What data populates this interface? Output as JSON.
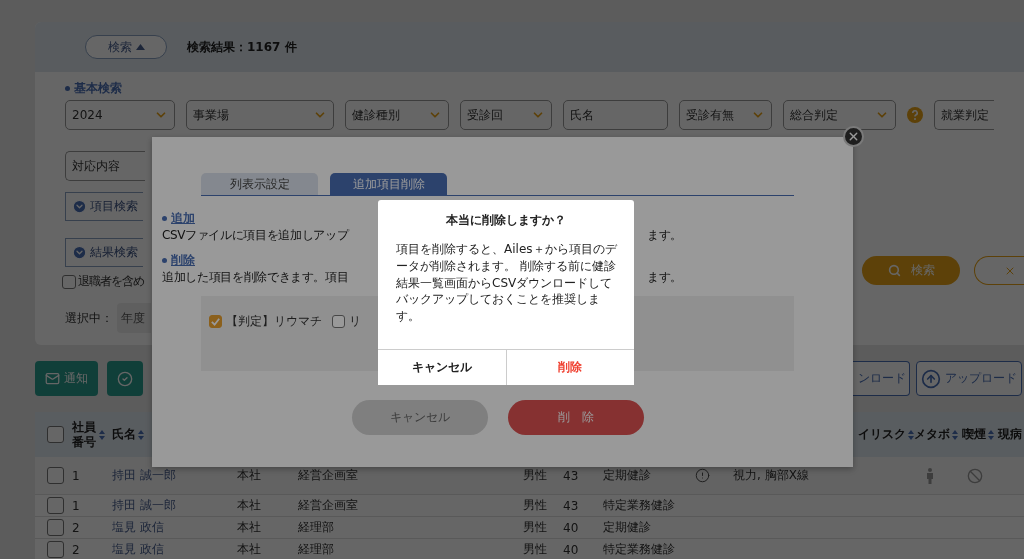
{
  "search_panel": {
    "toggle_button": "検索",
    "result_count": "検索結果：1167 件",
    "section_label": "基本検索",
    "filters": [
      {
        "kind": "select",
        "value": "2024"
      },
      {
        "kind": "select",
        "value": "事業場"
      },
      {
        "kind": "select",
        "value": "健診種別"
      },
      {
        "kind": "select",
        "value": "受診回"
      },
      {
        "kind": "input",
        "placeholder": "氏名"
      },
      {
        "kind": "select",
        "value": "受診有無"
      },
      {
        "kind": "select",
        "value": "総合判定"
      },
      {
        "kind": "help"
      },
      {
        "kind": "plain",
        "value": "就業判定"
      }
    ],
    "second_row": [
      {
        "kind": "select",
        "value": "対応内容"
      }
    ],
    "toggles": [
      "項目検索",
      "結果検索"
    ],
    "include_retired": {
      "label": "退職者を含め",
      "checked": false
    },
    "selection_label": "選択中：",
    "selection_chips": [
      "年度"
    ],
    "search_button": "検索"
  },
  "actions": [
    {
      "kind": "notify",
      "label": "通知"
    },
    {
      "kind": "confirm"
    },
    {
      "kind": "download",
      "label": "ンロード"
    },
    {
      "kind": "upload",
      "label": "アップロード"
    }
  ],
  "table": {
    "select_all": {
      "checked": false
    },
    "columns": [
      {
        "label": "社員番号",
        "sortable": true
      },
      {
        "label": "氏名",
        "sortable": true
      },
      {
        "label": "イリスク",
        "sortable": true
      },
      {
        "label": "メタボ",
        "sortable": true
      },
      {
        "label": "喫煙",
        "sortable": true
      },
      {
        "label": "現病",
        "sortable": false
      }
    ],
    "rows": [
      {
        "checked": false,
        "cells": [
          "1",
          "持田 誠一郎",
          "本社",
          "経営企画室",
          "男性",
          "43",
          "定期健診"
        ],
        "alert": true,
        "findings": "視力, 胸部X線",
        "metabo": true,
        "smoking": true
      },
      {
        "checked": false,
        "cells": [
          "1",
          "持田 誠一郎",
          "本社",
          "経営企画室",
          "男性",
          "43",
          "特定業務健診"
        ],
        "alert": false,
        "metabo": false,
        "smoking": false
      },
      {
        "checked": false,
        "cells": [
          "2",
          "塩見 政信",
          "本社",
          "経理部",
          "男性",
          "40",
          "定期健診"
        ],
        "alert": false,
        "metabo": false,
        "smoking": false
      },
      {
        "checked": false,
        "cells": [
          "2",
          "塩見 政信",
          "本社",
          "経理部",
          "男性",
          "40",
          "特定業務健診"
        ],
        "alert": false,
        "metabo": false,
        "smoking": false
      }
    ]
  },
  "modal": {
    "tabs": [
      {
        "label": "列表示設定",
        "selected": false
      },
      {
        "label": "追加項目削除",
        "selected": true
      }
    ],
    "sections": [
      {
        "heading": "追加",
        "text_parts": [
          "CSVファイルに項目を追加しアップ",
          "ます。"
        ]
      },
      {
        "heading": "削除",
        "text_parts": [
          "追加した項目を削除できます。項目",
          "ます。"
        ]
      }
    ],
    "items": [
      {
        "label": "【判定】リウマチ",
        "checked": true
      },
      {
        "label": "リ",
        "checked": false
      }
    ],
    "buttons": [
      {
        "kind": "secondary",
        "label": "キャンセル"
      },
      {
        "kind": "danger",
        "label": "削　除"
      }
    ]
  },
  "confirm": {
    "title": "本当に削除しますか？",
    "message": "項目を削除すると、Ailes＋から項目のデータが削除されます。 削除する前に健診結果一覧画面からCSVダウンロードしてバックアップしておくことを推奨します。",
    "buttons": [
      {
        "kind": "cancel",
        "label": "キャンセル"
      },
      {
        "kind": "delete",
        "label": "削除"
      }
    ]
  }
}
